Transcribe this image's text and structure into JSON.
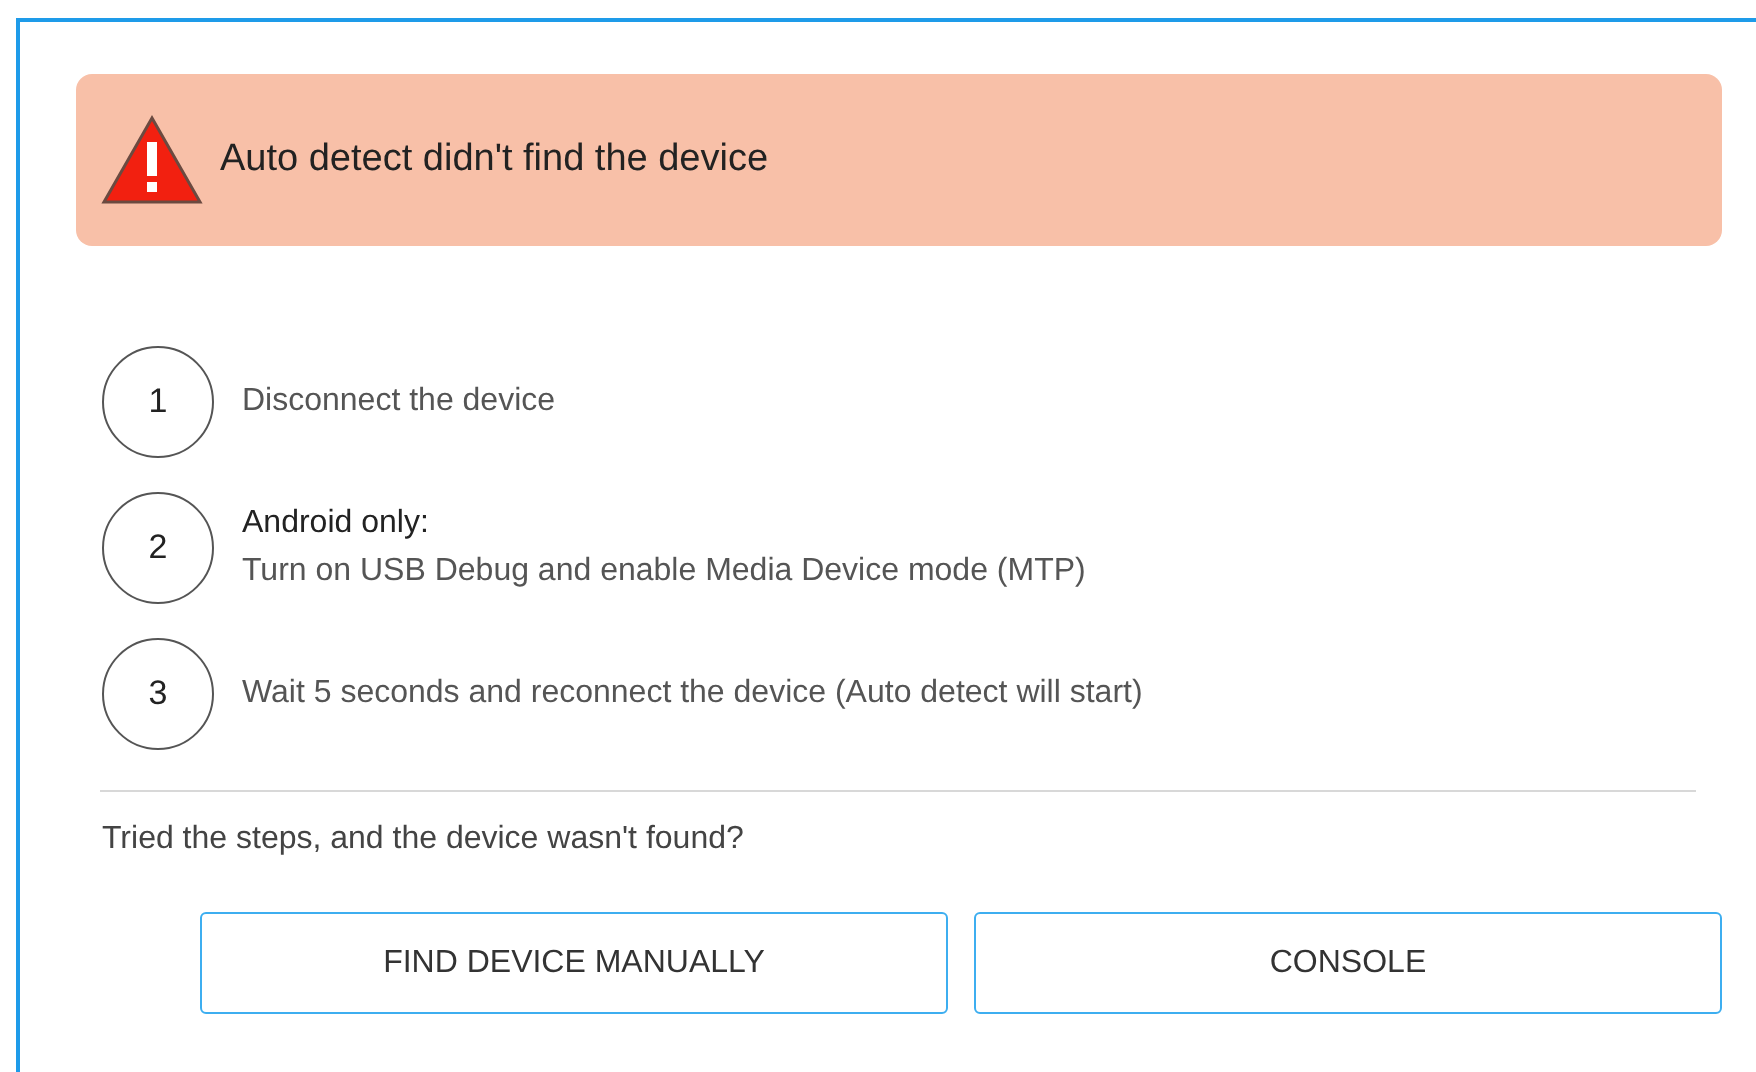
{
  "alert": {
    "message": "Auto detect didn't find the device"
  },
  "steps": [
    {
      "number": "1",
      "text": "Disconnect the device"
    },
    {
      "number": "2",
      "title": "Android only:",
      "text": "Turn on USB Debug and enable Media Device mode (MTP)"
    },
    {
      "number": "3",
      "text": "Wait 5 seconds and reconnect the device (Auto detect will start)"
    }
  ],
  "question": "Tried the steps, and the device wasn't found?",
  "buttons": [
    "FIND DEVICE MANUALLY",
    "CONSOLE"
  ]
}
